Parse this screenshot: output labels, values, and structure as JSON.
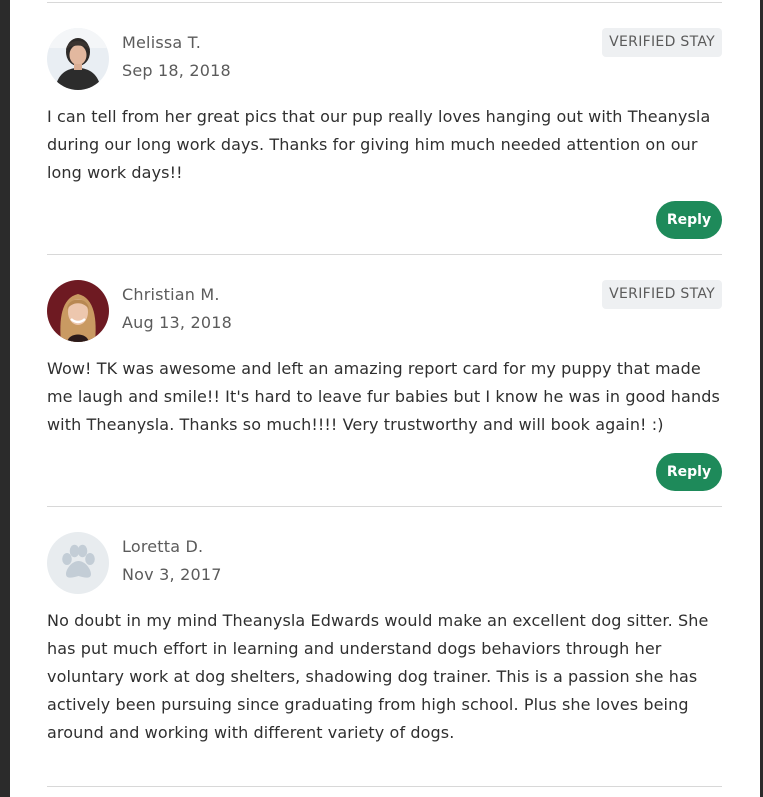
{
  "reviews": [
    {
      "name": "Melissa T.",
      "date": "Sep 18, 2018",
      "badge": "VERIFIED STAY",
      "text": "I can tell from her great pics that our pup really loves hanging out with Theanysla during our long work days. Thanks for giving him much needed attention on our long work days!!",
      "reply_label": "Reply",
      "avatar": "photo"
    },
    {
      "name": "Christian M.",
      "date": "Aug 13, 2018",
      "badge": "VERIFIED STAY",
      "text": "Wow! TK was awesome and left an amazing report card for my puppy that made me laugh and smile!! It's hard to leave fur babies but I know he was in good hands with Theanysla. Thanks so much!!!! Very trustworthy and will book again! :)",
      "reply_label": "Reply",
      "avatar": "photo"
    },
    {
      "name": "Loretta D.",
      "date": "Nov 3, 2017",
      "text": "No doubt in my mind Theanysla Edwards would make an excellent dog sitter. She has put much effort in learning and understand dogs behaviors through her voluntary work at dog shelters, shadowing dog trainer. This is a passion she has actively been pursuing since graduating from high school. Plus she loves being around and working with different variety of dogs.",
      "avatar": "paw-icon"
    }
  ],
  "colors": {
    "reply_button": "#1e8a5a",
    "badge_bg": "#eef0f2",
    "divider": "#d8d8d8",
    "page_bg": "#ffffff",
    "outer_bg": "#2b2b2b"
  }
}
